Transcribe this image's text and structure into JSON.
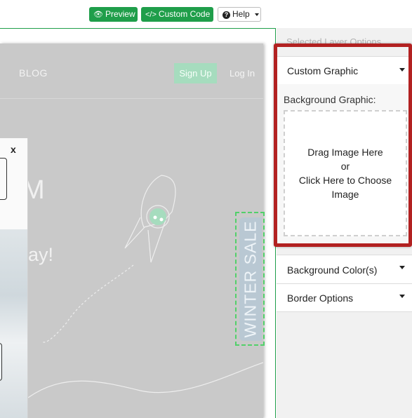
{
  "toolbar": {
    "preview_label": "Preview",
    "custom_code_label": "Custom Code",
    "help_label": "Help",
    "preview_icon": "eye-icon",
    "custom_code_icon": "code-icon",
    "accent_color": "#1f9e4a"
  },
  "site_preview": {
    "nav_blog": "BLOG",
    "signup_label": "Sign Up",
    "login_label": "Log In",
    "hero_fragment_1": "M",
    "hero_fragment_2": "ay!",
    "winter_sale": "WINTER SALE",
    "popup_close": "x"
  },
  "right_panel": {
    "title": "Selected Layer Options",
    "sections": [
      {
        "label": "Custom Graphic",
        "expanded": true
      },
      {
        "label": "Background Color(s)",
        "expanded": false
      },
      {
        "label": "Border Options",
        "expanded": false
      }
    ],
    "background_graphic_label": "Background Graphic:",
    "dropzone": {
      "line1": "Drag Image Here",
      "line2": "or",
      "line3": "Click Here to Choose",
      "line4": "Image"
    },
    "highlight_color": "#b22121"
  }
}
